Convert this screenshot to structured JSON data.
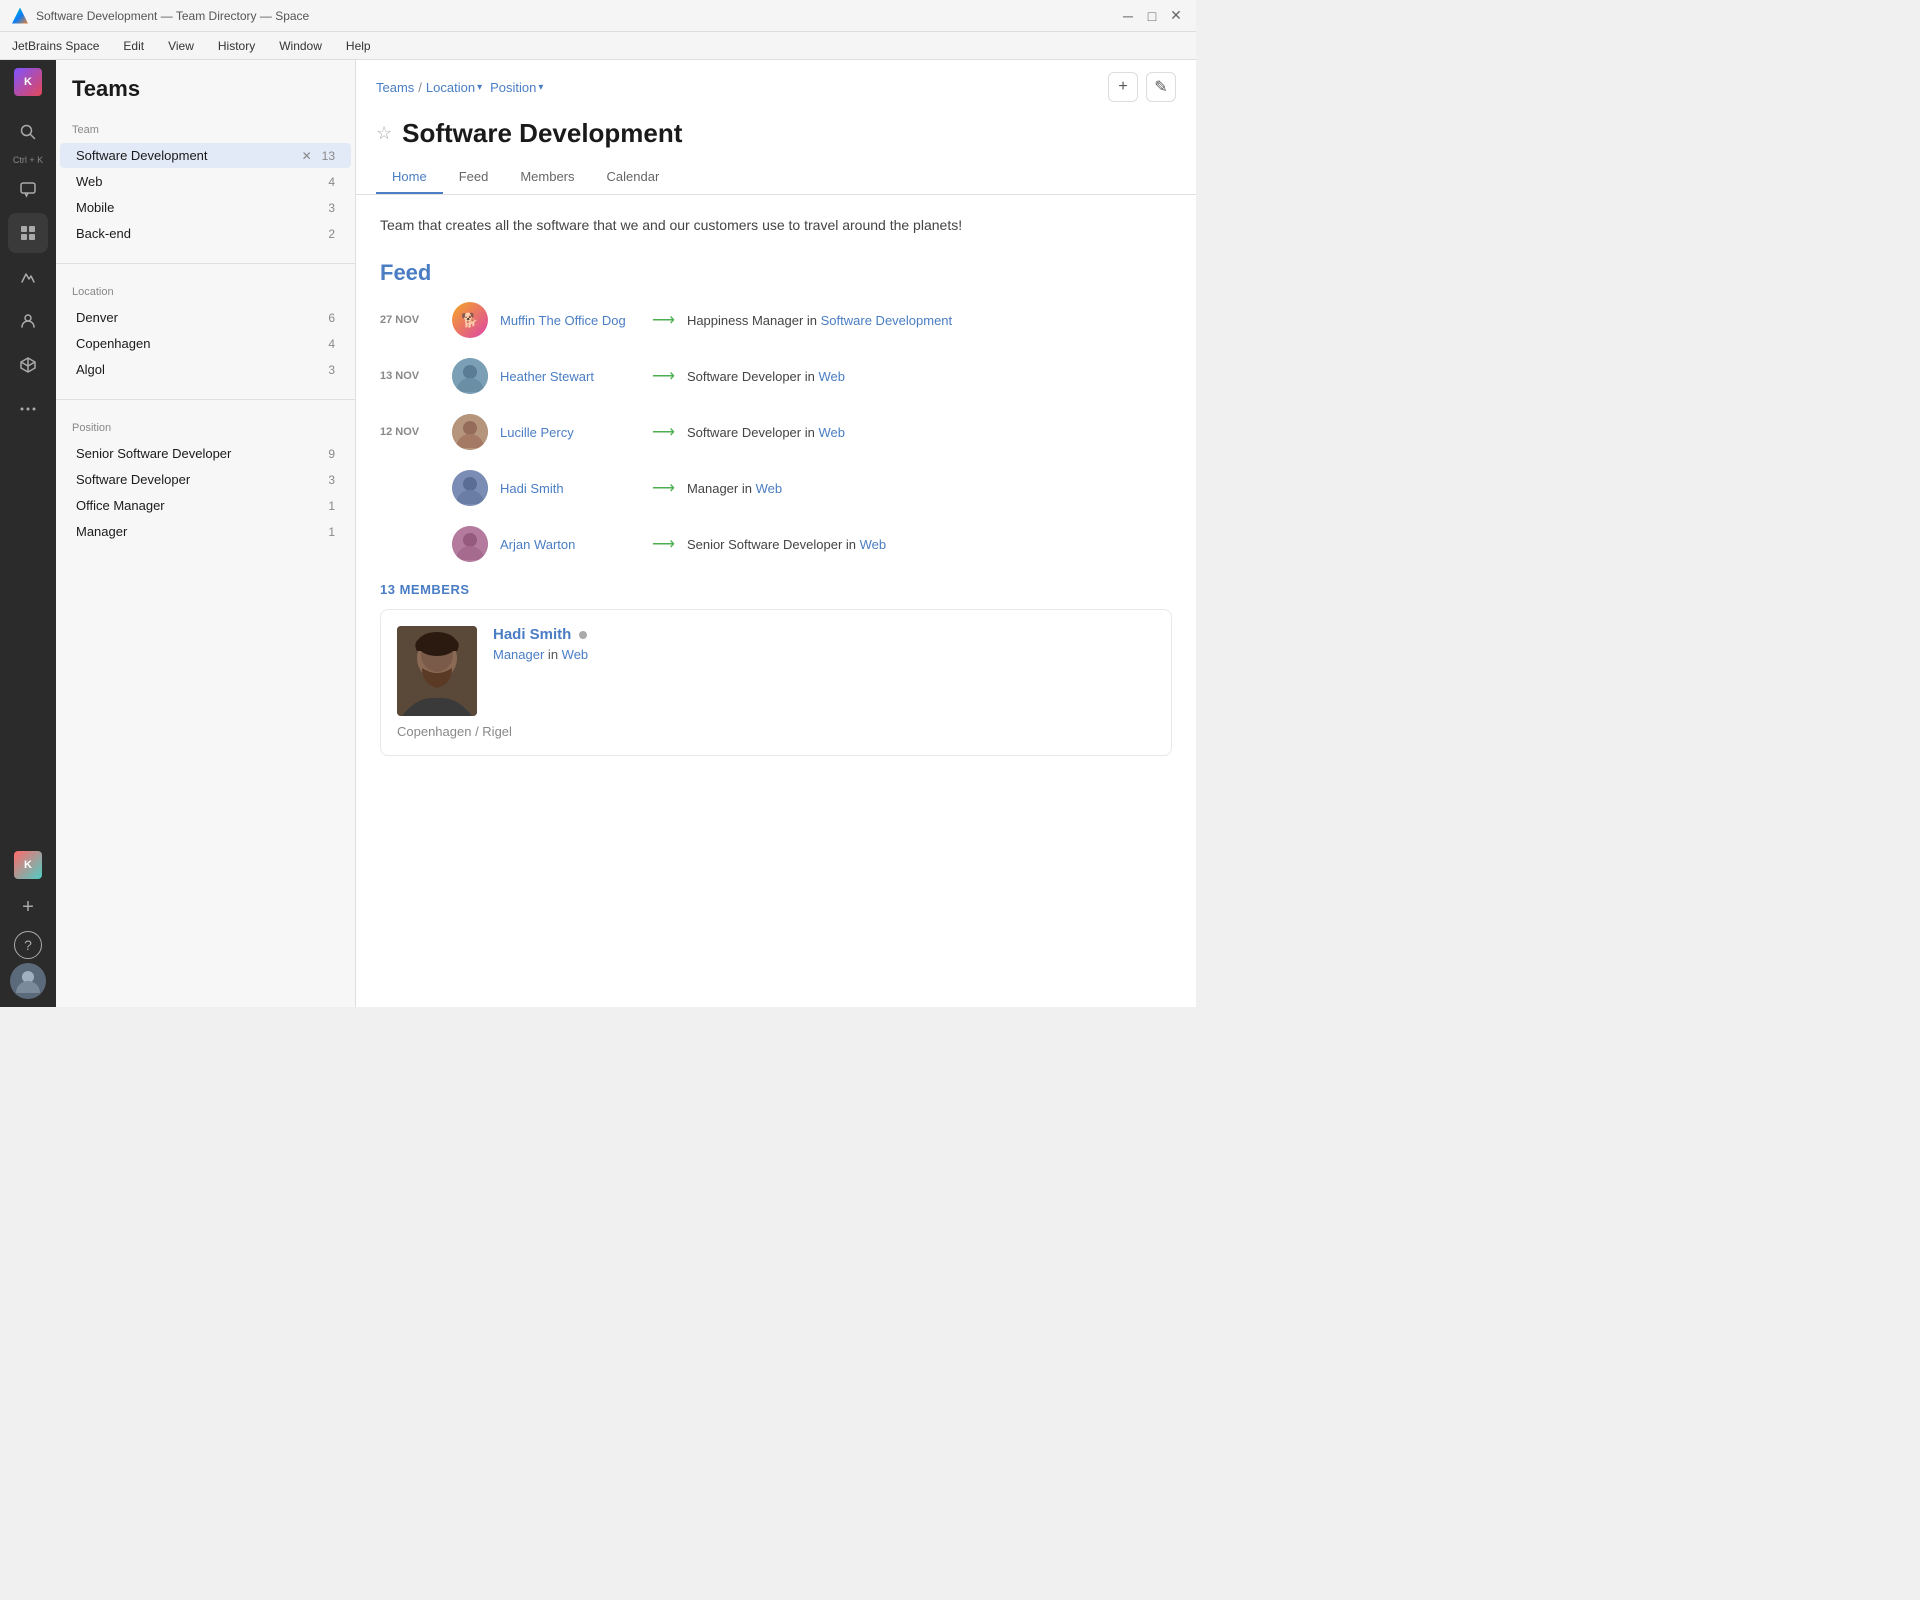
{
  "titlebar": {
    "title": "Software Development — Team Directory — Space",
    "controls": [
      "minimize",
      "maximize",
      "close"
    ]
  },
  "menubar": {
    "items": [
      "JetBrains Space",
      "Edit",
      "View",
      "History",
      "Window",
      "Help"
    ]
  },
  "sidebar": {
    "header": "Teams",
    "team_section_label": "Team",
    "teams": [
      {
        "name": "Software Development",
        "count": 13,
        "active": true
      },
      {
        "name": "Web",
        "count": 4
      },
      {
        "name": "Mobile",
        "count": 3
      },
      {
        "name": "Back-end",
        "count": 2
      }
    ],
    "location_section_label": "Location",
    "locations": [
      {
        "name": "Denver",
        "count": 6
      },
      {
        "name": "Copenhagen",
        "count": 4
      },
      {
        "name": "Algol",
        "count": 3
      }
    ],
    "position_section_label": "Position",
    "positions": [
      {
        "name": "Senior Software Developer",
        "count": 9
      },
      {
        "name": "Software Developer",
        "count": 3
      },
      {
        "name": "Office Manager",
        "count": 1
      },
      {
        "name": "Manager",
        "count": 1
      }
    ]
  },
  "breadcrumb": {
    "teams_label": "Teams",
    "separator": "/",
    "location_label": "Location",
    "position_label": "Position"
  },
  "team": {
    "title": "Software Development",
    "description": "Team that creates all the software that we and our customers use to travel around the planets!",
    "tabs": [
      "Home",
      "Feed",
      "Members",
      "Calendar"
    ],
    "active_tab": "Home"
  },
  "feed": {
    "title": "Feed",
    "items": [
      {
        "date": "27 NOV",
        "person": "Muffin The Office Dog",
        "action": "Happiness Manager in",
        "team": "Software Development",
        "team_link": "Software Development"
      },
      {
        "date": "13 NOV",
        "person": "Heather Stewart",
        "action": "Software Developer in",
        "team": "Web",
        "team_link": "Web"
      },
      {
        "date": "12 NOV",
        "person": "Lucille Percy",
        "action": "Software Developer in",
        "team": "Web",
        "team_link": "Web"
      },
      {
        "date": "",
        "person": "Hadi Smith",
        "action": "Manager in",
        "team": "Web",
        "team_link": "Web"
      },
      {
        "date": "",
        "person": "Arjan Warton",
        "action": "Senior Software Developer in",
        "team": "Web",
        "team_link": "Web"
      }
    ]
  },
  "members": {
    "count_label": "13 MEMBERS",
    "first_member": {
      "name": "Hadi Smith",
      "status": "away",
      "role": "Manager",
      "team": "Web",
      "location": "Copenhagen / Rigel"
    }
  },
  "actions": {
    "add_label": "+",
    "edit_label": "✎"
  }
}
